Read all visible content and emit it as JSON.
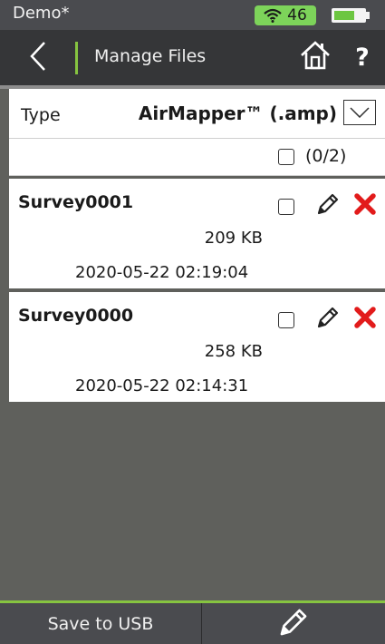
{
  "status": {
    "profile": "Demo*",
    "signal": "46",
    "battery_level": 0.7,
    "wifi_icon": "wifi-icon",
    "battery_icon": "battery-icon",
    "wifi_badge_color": "#7dd35a",
    "battery_fill_color": "#6cc641"
  },
  "nav": {
    "back_icon": "chevron-left-icon",
    "title": "Manage Files",
    "home_icon": "home-icon",
    "help_label": "?",
    "accent_color": "#86c440"
  },
  "type_filter": {
    "label": "Type",
    "value": "AirMapper™ (.amp)",
    "dropdown_icon": "chevron-down-icon"
  },
  "select_all": {
    "count": "(0/2)",
    "checked": false
  },
  "files": [
    {
      "name": "Survey0001",
      "size": "209 KB",
      "date": "2020-05-22 02:19:04",
      "checked": false
    },
    {
      "name": "Survey0000",
      "size": "258 KB",
      "date": "2020-05-22 02:14:31",
      "checked": false
    }
  ],
  "file_actions": {
    "edit_icon": "pencil-icon",
    "delete_icon": "delete-x-icon",
    "delete_color": "#e21b1b"
  },
  "bottom_bar": {
    "save_label": "Save to USB",
    "edit_icon": "pencil-icon"
  }
}
